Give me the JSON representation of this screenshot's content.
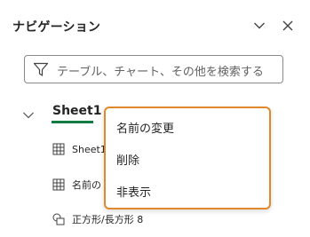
{
  "pane": {
    "title": "ナビゲーション"
  },
  "search": {
    "placeholder": "テーブル、チャート、その他を検索する"
  },
  "tree": {
    "sheet_name": "Sheet1",
    "items": [
      {
        "label": "Sheet1",
        "icon": "table-icon"
      },
      {
        "label": "名前の",
        "icon": "table-icon"
      },
      {
        "label": "正方形/長方形 8",
        "icon": "shapes-icon"
      }
    ]
  },
  "context_menu": {
    "items": [
      "名前の変更",
      "削除",
      "非表示"
    ]
  },
  "colors": {
    "accent_green": "#107c41",
    "menu_border": "#e08a2c"
  }
}
